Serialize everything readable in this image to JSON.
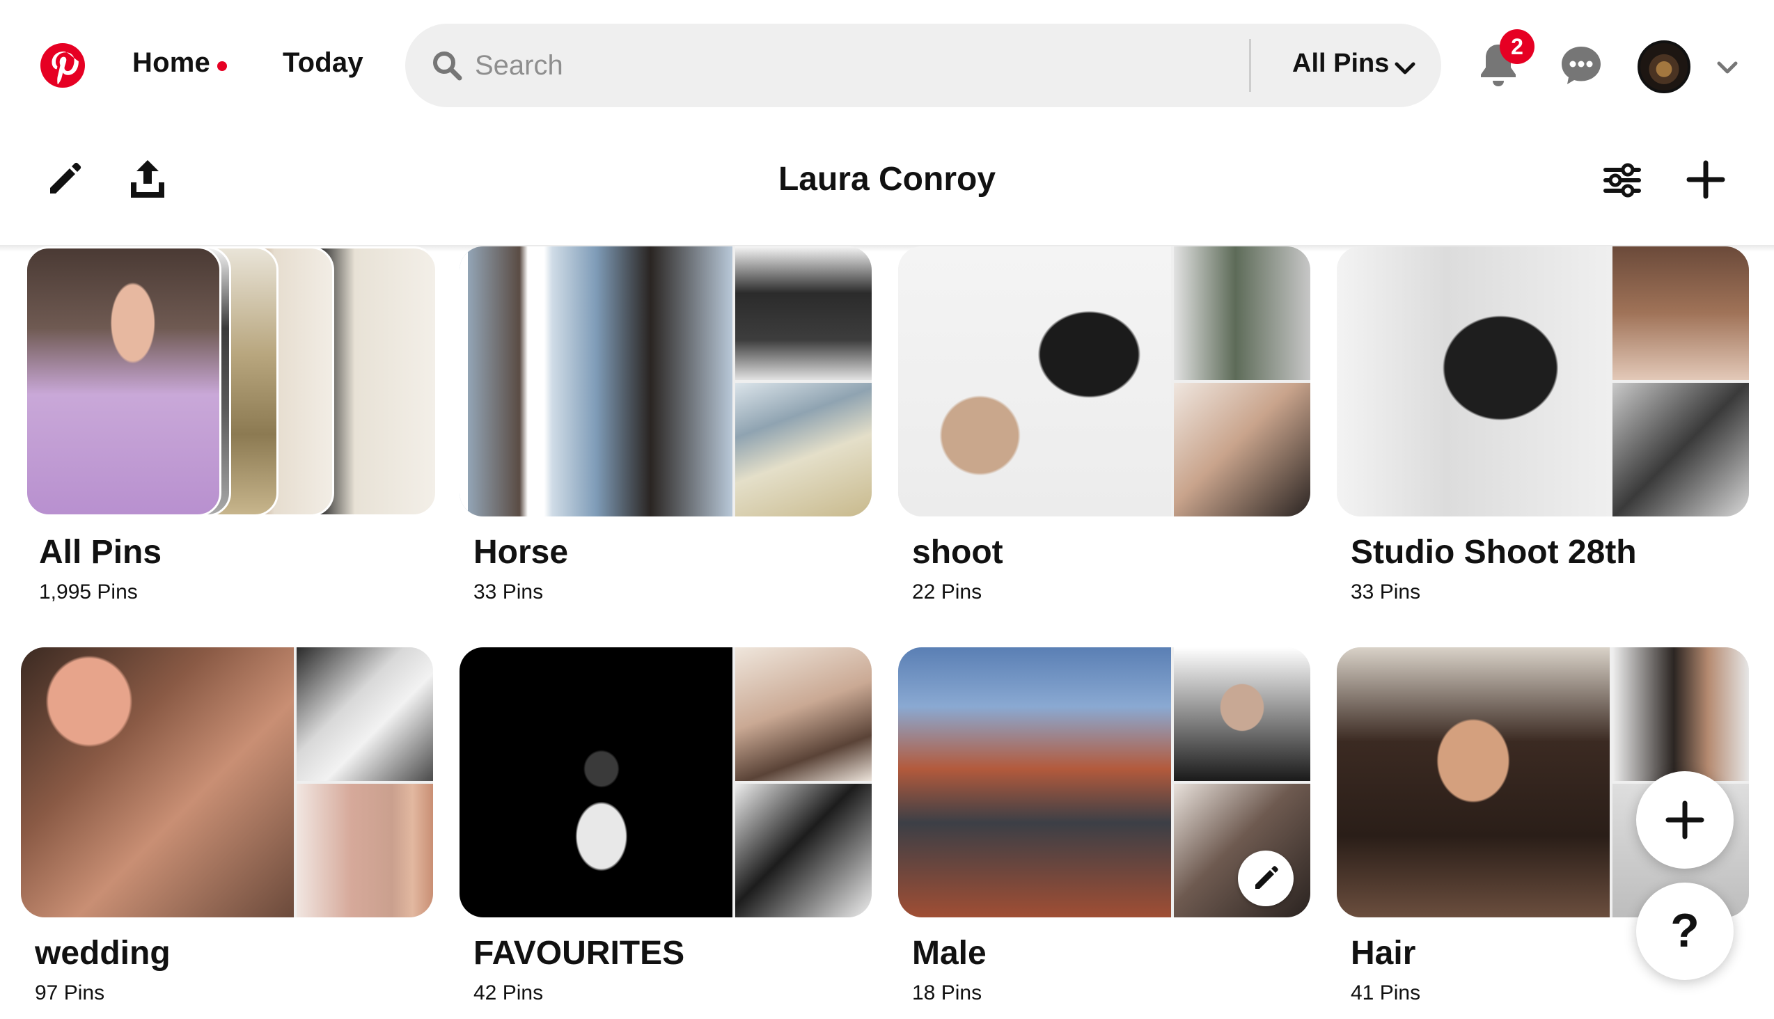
{
  "nav": {
    "home_label": "Home",
    "today_label": "Today",
    "brand_color": "#e60023"
  },
  "search": {
    "placeholder": "Search",
    "filter_label": "All Pins"
  },
  "notifications": {
    "count": "2"
  },
  "profile": {
    "name": "Laura Conroy"
  },
  "boards": [
    {
      "name": "All Pins",
      "count": "1,995 Pins"
    },
    {
      "name": "Horse",
      "count": "33 Pins"
    },
    {
      "name": "shoot",
      "count": "22 Pins"
    },
    {
      "name": "Studio Shoot 28th",
      "count": "33 Pins"
    },
    {
      "name": "wedding",
      "count": "97 Pins"
    },
    {
      "name": "FAVOURITES",
      "count": "42 Pins"
    },
    {
      "name": "Male",
      "count": "18 Pins"
    },
    {
      "name": "Hair",
      "count": "41 Pins"
    }
  ],
  "icons": {
    "logo": "pinterest-logo-icon",
    "search": "search-icon",
    "dropdown": "chevron-down-icon",
    "notifications": "bell-icon",
    "messages": "chat-bubble-icon",
    "edit_profile": "pencil-icon",
    "share": "share-icon",
    "filter": "sliders-icon",
    "create": "plus-icon",
    "help": "question-mark-icon"
  },
  "help_label": "?"
}
